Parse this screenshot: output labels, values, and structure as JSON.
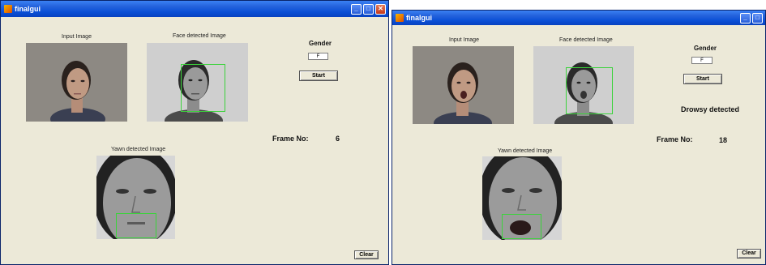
{
  "windows": [
    {
      "title": "finalgui",
      "labels": {
        "input_image": "Input Image",
        "face_detected": "Face detected Image",
        "yawn_detected": "Yawn detected Image",
        "gender": "Gender",
        "frame_no": "Frame No:"
      },
      "gender_value": "F",
      "start_button": "Start",
      "clear_button": "Clear",
      "frame_value": "6",
      "status": ""
    },
    {
      "title": "finalgui",
      "labels": {
        "input_image": "Input Image",
        "face_detected": "Face detected Image",
        "yawn_detected": "Yawn detected Image",
        "gender": "Gender",
        "frame_no": "Frame No:"
      },
      "gender_value": "F",
      "start_button": "Start",
      "clear_button": "Clear",
      "frame_value": "18",
      "status": "Drowsy detected"
    }
  ],
  "colors": {
    "panel_bg": "#ece9d8",
    "titlebar": "#0a4fd6",
    "detect_box": "#3cd23c"
  },
  "icons": [
    "matlab-app-icon",
    "minimize-icon",
    "maximize-icon",
    "close-icon"
  ]
}
